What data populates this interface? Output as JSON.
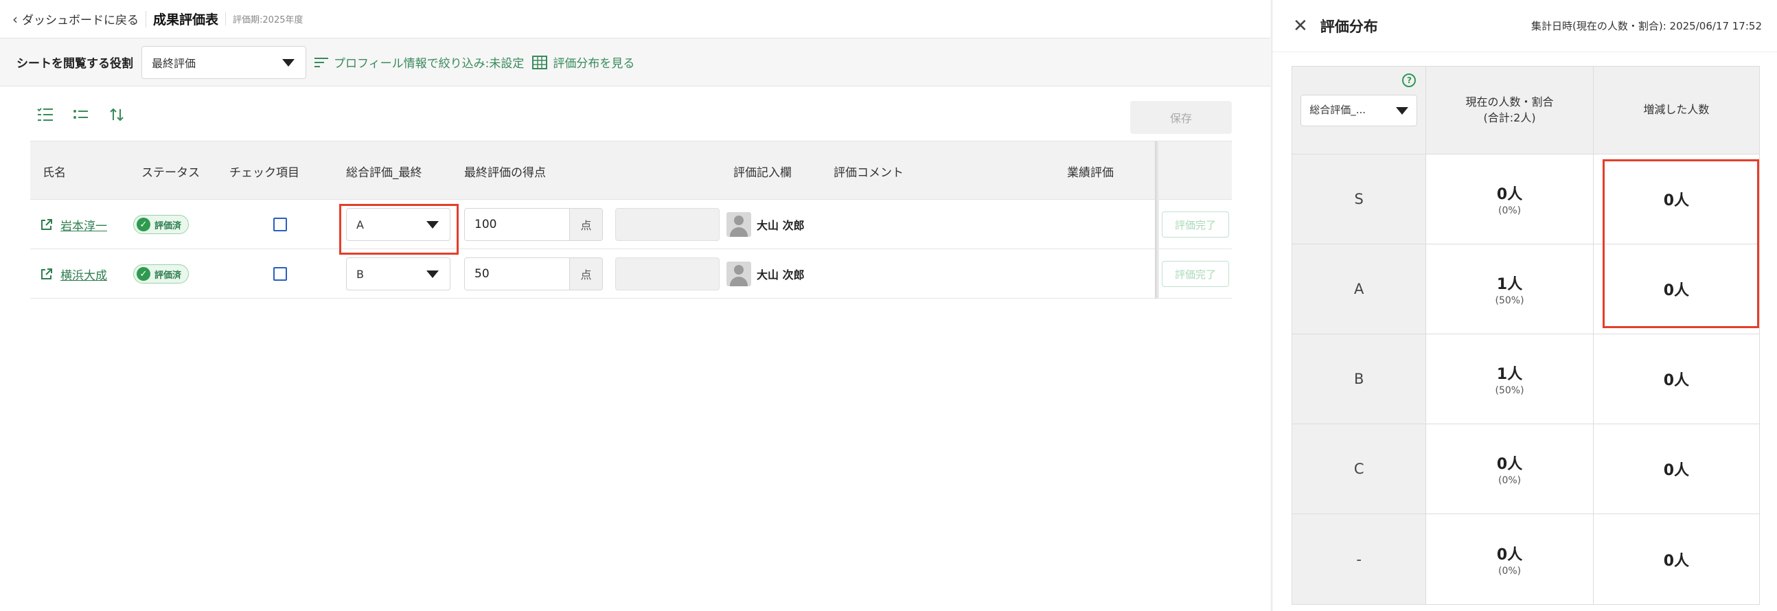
{
  "header": {
    "back_label": "ダッシュボードに戻る",
    "page_title": "成果評価表",
    "period": "評価期:2025年度"
  },
  "filters": {
    "role_label": "シートを閲覧する役割",
    "role_value": "最終評価",
    "profile_filter": "プロフィール情報で絞り込み:未設定",
    "distribution_link": "評価分布を見る"
  },
  "toolbar": {
    "save_label": "保存"
  },
  "table": {
    "headers": {
      "name": "氏名",
      "status": "ステータス",
      "check": "チェック項目",
      "overall": "総合評価_最終",
      "score": "最終評価の得点",
      "entry": "評価記入欄",
      "comment": "評価コメント",
      "performance": "業績評価"
    },
    "rows": [
      {
        "name": "岩本淳一",
        "status": "評価済",
        "grade": "A",
        "score": "100",
        "unit": "点",
        "evaluator": "大山 次郎",
        "done_label": "評価完了"
      },
      {
        "name": "横浜大成",
        "status": "評価済",
        "grade": "B",
        "score": "50",
        "unit": "点",
        "evaluator": "大山 次郎",
        "done_label": "評価完了"
      }
    ]
  },
  "panel": {
    "title": "評価分布",
    "date": "集計日時(現在の人数・割合): 2025/06/17 17:52",
    "header": {
      "selector": "総合評価_...",
      "col_current": "現在の人数・割合",
      "col_total": "(合計:2人)",
      "col_delta": "増減した人数"
    },
    "rows": [
      {
        "grade": "S",
        "count": "0人",
        "pct": "(0%)",
        "delta": "0人"
      },
      {
        "grade": "A",
        "count": "1人",
        "pct": "(50%)",
        "delta": "0人"
      },
      {
        "grade": "B",
        "count": "1人",
        "pct": "(50%)",
        "delta": "0人"
      },
      {
        "grade": "C",
        "count": "0人",
        "pct": "(0%)",
        "delta": "0人"
      },
      {
        "grade": "-",
        "count": "0人",
        "pct": "(0%)",
        "delta": "0人"
      }
    ]
  },
  "colors": {
    "accent_green": "#2e7d4f",
    "highlight_red": "#e53e2a",
    "checkbox_blue": "#2a5fbf"
  }
}
